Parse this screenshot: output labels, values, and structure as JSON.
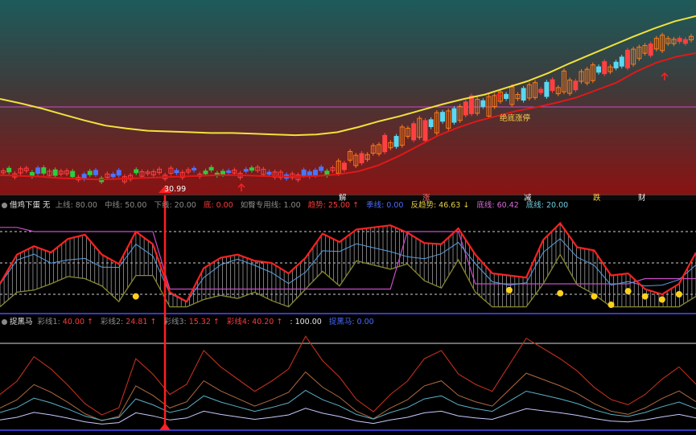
{
  "colors": {
    "ma_long": "#f0e23c",
    "ma_short": "#e01818",
    "up_candle": "#ff7a1a",
    "down_candle": "#5ad8f0",
    "small_up": "#ff4040",
    "small_down": "#4a74ff",
    "green_candle": "#2ecc40"
  },
  "panel1": {
    "price_low_label": "30.99",
    "stock_break_label": "绝底涨停",
    "event_labels": [
      "解",
      "涨",
      "减",
      "跌",
      "财"
    ]
  },
  "panel2": {
    "name": "借鸡下蛋 无",
    "items": [
      {
        "label": "上线:",
        "value": "80.00"
      },
      {
        "label": "中线:",
        "value": "50.00"
      },
      {
        "label": "下线:",
        "value": "20.00"
      },
      {
        "label": "底:",
        "value": "0.00"
      },
      {
        "label": "如臀专用线:",
        "value": "1.00"
      },
      {
        "label": "趋势:",
        "value": "25.00",
        "arrow": "↑"
      },
      {
        "label": "季线:",
        "value": "0.00"
      },
      {
        "label": "反趋势:",
        "value": "46.63",
        "arrow": "↓"
      },
      {
        "label": "底线:",
        "value": "60.42"
      },
      {
        "label": "底线:",
        "value": "20.00"
      }
    ]
  },
  "panel3": {
    "name": "捉黑马",
    "items": [
      {
        "label": "彩线1:",
        "value": "40.00",
        "arrow": "↑"
      },
      {
        "label": "彩线2:",
        "value": "24.81",
        "arrow": "↑"
      },
      {
        "label": "彩线3:",
        "value": "15.32",
        "arrow": "↑"
      },
      {
        "label": "彩线4:",
        "value": "40.20",
        "arrow": "↑"
      },
      {
        "label": ":",
        "value": "100.00"
      },
      {
        "label": "捉黑马:",
        "value": "0.00"
      }
    ]
  },
  "chart_data": [
    {
      "type": "line",
      "description_role": "price panel with candlesticks and moving averages",
      "annotations": [
        "30.99",
        "绝底涨停"
      ],
      "series": [
        {
          "values": [
            112,
            118,
            125,
            133,
            141,
            148,
            152,
            155,
            156,
            157,
            158,
            158,
            159,
            160,
            161,
            160,
            157,
            150,
            142,
            135,
            127,
            119,
            112,
            106,
            97,
            88,
            77,
            64,
            52,
            40,
            28,
            17,
            7,
            0
          ]
        },
        {
          "values": [
            215,
            216,
            217,
            219,
            220,
            221,
            220,
            219,
            218,
            217,
            216,
            215,
            215,
            216,
            217,
            217,
            216,
            214,
            210,
            202,
            190,
            176,
            162,
            151,
            142,
            135,
            128,
            123,
            117,
            110,
            100,
            90,
            75,
            63,
            55,
            50
          ]
        }
      ]
    },
    {
      "type": "line",
      "description_role": "借鸡下蛋 oscillator",
      "ylim": [
        0,
        100
      ],
      "series": [
        {
          "values": [
            30,
            58,
            66,
            60,
            73,
            77,
            58,
            49,
            80,
            68,
            22,
            13,
            45,
            55,
            58,
            52,
            50,
            40,
            55,
            78,
            70,
            82,
            84,
            86,
            79,
            69,
            68,
            83,
            58,
            40,
            38,
            36,
            72,
            88,
            65,
            62,
            38,
            40,
            25,
            20,
            30,
            60
          ]
        },
        {
          "values": [
            84,
            84,
            80,
            80,
            80,
            80,
            80,
            80,
            80,
            80,
            25,
            25,
            25,
            25,
            25,
            25,
            25,
            25,
            25,
            25,
            25,
            25,
            25,
            25,
            80,
            80,
            80,
            80,
            30,
            30,
            30,
            30,
            30,
            30,
            30,
            30,
            30,
            30,
            35,
            35,
            35,
            35
          ]
        }
      ]
    },
    {
      "type": "line",
      "description_role": "捉黑马 oscillator",
      "series": [
        {
          "values": [
            35,
            48,
            72,
            60,
            44,
            26,
            15,
            22,
            70,
            55,
            35,
            45,
            78,
            62,
            50,
            38,
            48,
            60,
            92,
            68,
            52,
            30,
            18,
            35,
            48,
            70,
            78,
            55,
            45,
            38,
            64,
            90,
            80,
            70,
            58,
            42,
            30,
            25,
            35,
            50,
            62,
            45
          ]
        }
      ]
    }
  ]
}
